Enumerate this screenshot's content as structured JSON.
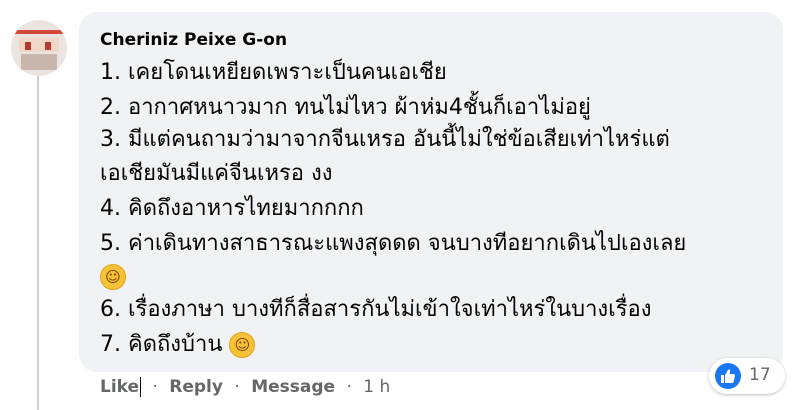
{
  "comment": {
    "author": "Cheriniz Peixe G-on",
    "lines": [
      "1. เคยโดนเหยียดเพราะเป็นคนเอเชีย",
      "2. อากาศหนาวมาก ทนไม่ไหว ผ้าห่ม4ชั้นก็เอาไม่อยู่",
      "3. มีแต่คนถามว่ามาจากจีนเหรอ อันนี้ไม่ใช่ข้อเสียเท่าไหร่แต่",
      "เอเชียมันมีแค่จีนเหรอ งง",
      "4. คิดถึงอาหารไทยมากกกก",
      "5. ค่าเดินทางสาธารณะแพงสุดดด จนบางทีอยากเดินไปเองเลย",
      "",
      "6. เรื่องภาษา บางทีก็สื่อสารกันไม่เข้าใจเท่าไหร่ในบางเรื่อง",
      "7. คิดถึงบ้าน"
    ],
    "emoji_icon": "rolling-on-floor-laughing-emoji"
  },
  "actions": {
    "like": "Like",
    "reply": "Reply",
    "message": "Message",
    "separator": "·",
    "time": "1 h"
  },
  "reactions": {
    "icon": "like-icon",
    "count": "17",
    "color": "#1877f2"
  }
}
